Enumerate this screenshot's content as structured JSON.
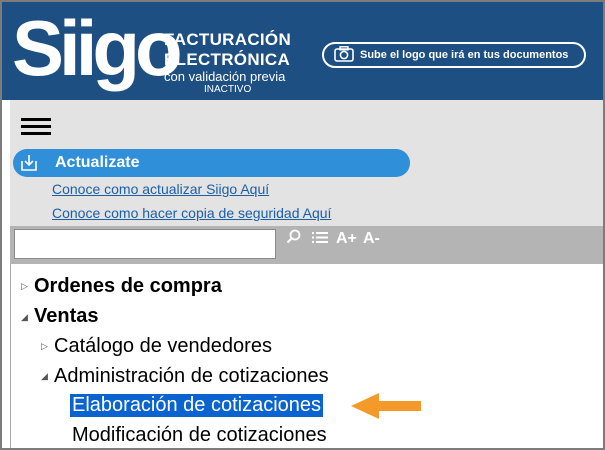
{
  "header": {
    "logo": "Siigo",
    "brand_line1": "FACTURACIÓN",
    "brand_line2": "ELECTRÓNICA",
    "brand_line3": "con validación previa",
    "brand_status": "INACTIVO",
    "upload_logo_label": "Sube el logo que irá en tus documentos"
  },
  "update": {
    "title": "Actualizate",
    "link_update": "Conoce como actualizar Siigo Aquí",
    "link_backup": "Conoce como hacer copia de seguridad Aquí"
  },
  "search": {
    "value": "",
    "font_increase": "A+",
    "font_decrease": "A-"
  },
  "tree": {
    "items": [
      {
        "label": "Ordenes de compra"
      },
      {
        "label": "Ventas"
      },
      {
        "label": "Catálogo de vendedores"
      },
      {
        "label": "Administración de cotizaciones"
      },
      {
        "label": "Elaboración de cotizaciones"
      },
      {
        "label": "Modificación de cotizaciones"
      }
    ]
  },
  "colors": {
    "header_bg": "#1d4f83",
    "accent_blue": "#2f8fd8",
    "selection": "#0a63cf",
    "arrow": "#f39a2b"
  }
}
